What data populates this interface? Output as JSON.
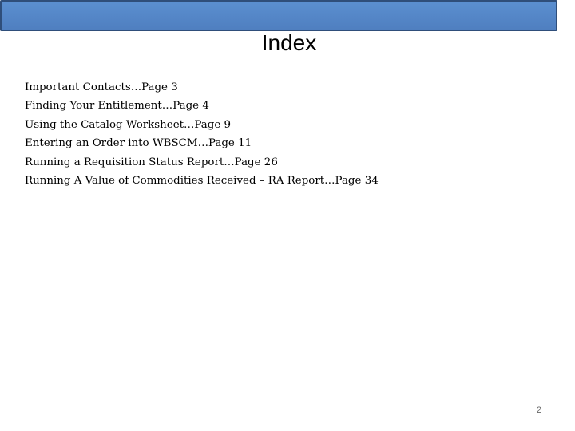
{
  "slide": {
    "title": "Index",
    "items": [
      "Important Contacts…Page 3",
      "Finding Your Entitlement…Page 4",
      "Using the Catalog Worksheet…Page 9",
      "Entering an Order into WBSCM…Page 11",
      "Running a Requisition Status Report…Page 26",
      "Running A Value of Commodities Received – RA Report…Page 34"
    ],
    "page_number": "2"
  },
  "colors": {
    "header_bar_fill": "#5b8fd0",
    "header_bar_border": "#2f4e7a"
  }
}
